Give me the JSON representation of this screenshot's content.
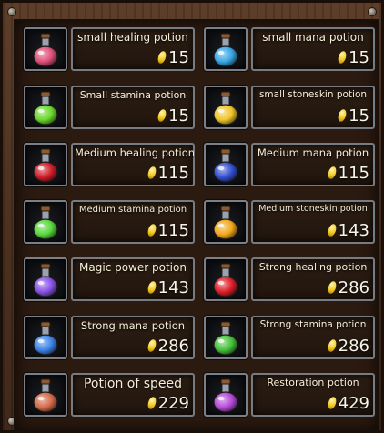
{
  "potions": [
    {
      "name": "small healing potion",
      "price": "15",
      "icon": "small-red-flask-icon",
      "color": "#e0507a"
    },
    {
      "name": "small mana potion",
      "price": "15",
      "icon": "small-blue-flask-icon",
      "color": "#3aa7e6"
    },
    {
      "name": "Small stamina potion",
      "price": "15",
      "icon": "small-green-flask-icon",
      "color": "#6ad82a"
    },
    {
      "name": "small stoneskin potion",
      "price": "15",
      "icon": "small-yellow-flask-icon",
      "color": "#f0c52a"
    },
    {
      "name": "Medium healing potion",
      "price": "115",
      "icon": "medium-red-flask-icon",
      "color": "#cf1e2a"
    },
    {
      "name": "Medium mana potion",
      "price": "115",
      "icon": "medium-blue-flask-icon",
      "color": "#3550d0"
    },
    {
      "name": "Medium stamina potion",
      "price": "115",
      "icon": "medium-green-flask-icon",
      "color": "#58d83c"
    },
    {
      "name": "Medium stoneskin potion",
      "price": "143",
      "icon": "medium-yellow-flask-icon",
      "color": "#f2a81c"
    },
    {
      "name": "Magic power potion",
      "price": "143",
      "icon": "purple-crystal-flask-icon",
      "color": "#8a52e8"
    },
    {
      "name": "Strong healing potion",
      "price": "286",
      "icon": "round-red-flask-icon",
      "color": "#e0202a"
    },
    {
      "name": "Strong mana potion",
      "price": "286",
      "icon": "large-blue-flask-icon",
      "color": "#3d84e8"
    },
    {
      "name": "Strong stamina potion",
      "price": "286",
      "icon": "tall-green-flask-icon",
      "color": "#46c23a"
    },
    {
      "name": "Potion of speed",
      "price": "229",
      "icon": "orange-bottle-icon",
      "color": "#d46a4a"
    },
    {
      "name": "Restoration potion",
      "price": "429",
      "icon": "violet-gem-flask-icon",
      "color": "#b64ad8"
    }
  ]
}
